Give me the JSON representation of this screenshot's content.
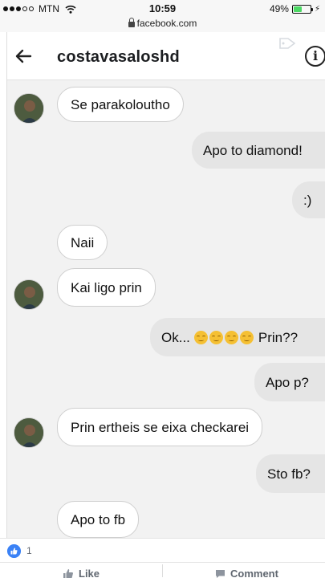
{
  "status_bar": {
    "carrier": "MTN",
    "time": "10:59",
    "battery_percent": "49%",
    "battery_level": 0.49,
    "signal_filled": 3,
    "signal_total": 5
  },
  "url_bar": {
    "url": "facebook.com"
  },
  "conversation": {
    "title": "costavasaloshd",
    "messages": [
      {
        "side": "in",
        "text": "Se parakoloutho",
        "avatar": true
      },
      {
        "side": "out",
        "text": "Apo to diamond!"
      },
      {
        "side": "out",
        "text": ":)"
      },
      {
        "side": "in",
        "text": "Naii",
        "avatar": false
      },
      {
        "side": "in",
        "text": "Kai ligo prin",
        "avatar": true
      },
      {
        "side": "out",
        "text_before": "Ok...",
        "emoji_count": 4,
        "text_after": "Prin??"
      },
      {
        "side": "out",
        "text": "Apo p?"
      },
      {
        "side": "in",
        "text": "Prin ertheis se eixa checkarei",
        "avatar": true
      },
      {
        "side": "out",
        "text": "Sto fb?"
      },
      {
        "side": "in",
        "text": "Apo to fb",
        "avatar": false
      }
    ]
  },
  "reactions": {
    "like_count": "1"
  },
  "actions": {
    "like_label": "Like",
    "comment_label": "Comment"
  },
  "colors": {
    "like_blue": "#3b82f6",
    "incoming_bg": "#ffffff",
    "outgoing_bg": "#e5e5e5"
  }
}
